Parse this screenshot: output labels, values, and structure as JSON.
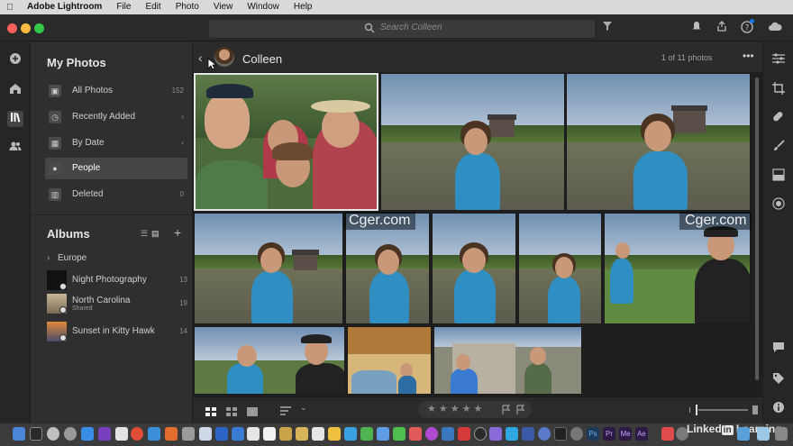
{
  "menubar": {
    "apple": "",
    "items": [
      "Adobe Lightroom",
      "File",
      "Edit",
      "Photo",
      "View",
      "Window",
      "Help"
    ]
  },
  "search": {
    "placeholder": "Search Colleen"
  },
  "sidebar": {
    "my_photos_title": "My Photos",
    "items": [
      {
        "label": "All Photos",
        "count": "152",
        "icon": "photos-icon"
      },
      {
        "label": "Recently Added",
        "count": "",
        "icon": "clock-icon"
      },
      {
        "label": "By Date",
        "count": "",
        "icon": "calendar-icon"
      },
      {
        "label": "People",
        "count": "",
        "icon": "person-icon"
      },
      {
        "label": "Deleted",
        "count": "0",
        "icon": "trash-icon"
      }
    ],
    "albums_title": "Albums",
    "albums": [
      {
        "label": "Europe",
        "count": ""
      },
      {
        "label": "Night Photography",
        "count": "13",
        "sub": ""
      },
      {
        "label": "North Carolina",
        "count": "19",
        "sub": "Shared"
      },
      {
        "label": "Sunset in Kitty Hawk",
        "count": "14",
        "sub": ""
      }
    ]
  },
  "main": {
    "person_name": "Colleen",
    "count_label": "1 of 11 photos"
  },
  "watermarks": [
    "Cger.com",
    "Cger.com"
  ],
  "bottom": {
    "stars": "★★★★★"
  },
  "dock": {
    "brand_text": "Linked",
    "brand_in": "in",
    "brand_suffix": "Learning"
  },
  "colors": {
    "accent": "#1473e6",
    "panel": "#2f2f2f",
    "selected": "#454545"
  }
}
